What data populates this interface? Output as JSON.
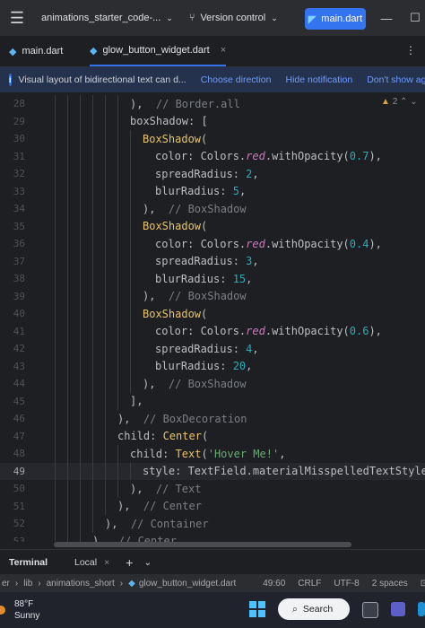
{
  "titlebar": {
    "project": "animations_starter_code-...",
    "version_control": "Version control",
    "run_config": "main.dart"
  },
  "tabs": [
    {
      "label": "main.dart"
    },
    {
      "label": "glow_button_widget.dart"
    }
  ],
  "notification": {
    "message": "Visual layout of bidirectional text can d...",
    "choose_direction": "Choose direction",
    "hide": "Hide notification",
    "dont_show": "Don't show again"
  },
  "editor": {
    "warning_count": "2",
    "lines": [
      {
        "num": "28",
        "indent": 145,
        "segs": [
          [
            "p",
            "),  "
          ],
          [
            "c",
            "// Border.all"
          ]
        ]
      },
      {
        "num": "29",
        "indent": 145,
        "segs": [
          [
            "p",
            "boxShadow: ["
          ]
        ]
      },
      {
        "num": "30",
        "indent": 159,
        "segs": [
          [
            "cls",
            "BoxShadow"
          ],
          [
            "p",
            "("
          ]
        ]
      },
      {
        "num": "31",
        "indent": 173,
        "segs": [
          [
            "p",
            "color: Colors."
          ],
          [
            "prop",
            "red"
          ],
          [
            "p",
            ".withOpacity("
          ],
          [
            "n",
            "0.7"
          ],
          [
            "p",
            "),"
          ]
        ]
      },
      {
        "num": "32",
        "indent": 173,
        "segs": [
          [
            "p",
            "spreadRadius: "
          ],
          [
            "n",
            "2"
          ],
          [
            "p",
            ","
          ]
        ]
      },
      {
        "num": "33",
        "indent": 173,
        "segs": [
          [
            "p",
            "blurRadius: "
          ],
          [
            "n",
            "5"
          ],
          [
            "p",
            ","
          ]
        ]
      },
      {
        "num": "34",
        "indent": 159,
        "segs": [
          [
            "p",
            "),  "
          ],
          [
            "c",
            "// BoxShadow"
          ]
        ]
      },
      {
        "num": "35",
        "indent": 159,
        "segs": [
          [
            "cls",
            "BoxShadow"
          ],
          [
            "p",
            "("
          ]
        ]
      },
      {
        "num": "36",
        "indent": 173,
        "segs": [
          [
            "p",
            "color: Colors."
          ],
          [
            "prop",
            "red"
          ],
          [
            "p",
            ".withOpacity("
          ],
          [
            "n",
            "0.4"
          ],
          [
            "p",
            "),"
          ]
        ]
      },
      {
        "num": "37",
        "indent": 173,
        "segs": [
          [
            "p",
            "spreadRadius: "
          ],
          [
            "n",
            "3"
          ],
          [
            "p",
            ","
          ]
        ]
      },
      {
        "num": "38",
        "indent": 173,
        "segs": [
          [
            "p",
            "blurRadius: "
          ],
          [
            "n",
            "15"
          ],
          [
            "p",
            ","
          ]
        ]
      },
      {
        "num": "39",
        "indent": 159,
        "segs": [
          [
            "p",
            "),  "
          ],
          [
            "c",
            "// BoxShadow"
          ]
        ]
      },
      {
        "num": "40",
        "indent": 159,
        "segs": [
          [
            "cls",
            "BoxShadow"
          ],
          [
            "p",
            "("
          ]
        ]
      },
      {
        "num": "41",
        "indent": 173,
        "segs": [
          [
            "p",
            "color: Colors."
          ],
          [
            "prop",
            "red"
          ],
          [
            "p",
            ".withOpacity("
          ],
          [
            "n",
            "0.6"
          ],
          [
            "p",
            "),"
          ]
        ]
      },
      {
        "num": "42",
        "indent": 173,
        "segs": [
          [
            "p",
            "spreadRadius: "
          ],
          [
            "n",
            "4"
          ],
          [
            "p",
            ","
          ]
        ]
      },
      {
        "num": "43",
        "indent": 173,
        "segs": [
          [
            "p",
            "blurRadius: "
          ],
          [
            "n",
            "20"
          ],
          [
            "p",
            ","
          ]
        ]
      },
      {
        "num": "44",
        "indent": 159,
        "segs": [
          [
            "p",
            "),  "
          ],
          [
            "c",
            "// BoxShadow"
          ]
        ]
      },
      {
        "num": "45",
        "indent": 145,
        "segs": [
          [
            "p",
            "],"
          ]
        ]
      },
      {
        "num": "46",
        "indent": 131,
        "segs": [
          [
            "p",
            "),  "
          ],
          [
            "c",
            "// BoxDecoration"
          ]
        ]
      },
      {
        "num": "47",
        "indent": 131,
        "segs": [
          [
            "p",
            "child: "
          ],
          [
            "cls",
            "Center"
          ],
          [
            "p",
            "("
          ]
        ]
      },
      {
        "num": "48",
        "indent": 145,
        "segs": [
          [
            "p",
            "child: "
          ],
          [
            "cls",
            "Text"
          ],
          [
            "p",
            "("
          ],
          [
            "s",
            "'Hover Me!'"
          ],
          [
            "p",
            ","
          ]
        ]
      },
      {
        "num": "49",
        "indent": 159,
        "segs": [
          [
            "p",
            "style: TextField.materialMisspelledTextStyle"
          ]
        ],
        "current": true
      },
      {
        "num": "50",
        "indent": 145,
        "segs": [
          [
            "p",
            "),  "
          ],
          [
            "c",
            "// Text"
          ]
        ]
      },
      {
        "num": "51",
        "indent": 131,
        "segs": [
          [
            "p",
            "),  "
          ],
          [
            "c",
            "// Center"
          ]
        ]
      },
      {
        "num": "52",
        "indent": 117,
        "segs": [
          [
            "p",
            "),  "
          ],
          [
            "c",
            "// Container"
          ]
        ]
      },
      {
        "num": "53",
        "indent": 103,
        "segs": [
          [
            "p",
            "),  "
          ],
          [
            "c",
            "// Center"
          ]
        ]
      }
    ]
  },
  "terminal": {
    "title": "Terminal",
    "tab": "Local"
  },
  "statusbar": {
    "crumbs": [
      "er",
      "lib",
      "animations_short",
      "glow_button_widget.dart"
    ],
    "position": "49:60",
    "line_sep": "CRLF",
    "encoding": "UTF-8",
    "indent": "2 spaces"
  },
  "taskbar": {
    "temperature": "88°F",
    "condition": "Sunny",
    "search": "Search"
  }
}
